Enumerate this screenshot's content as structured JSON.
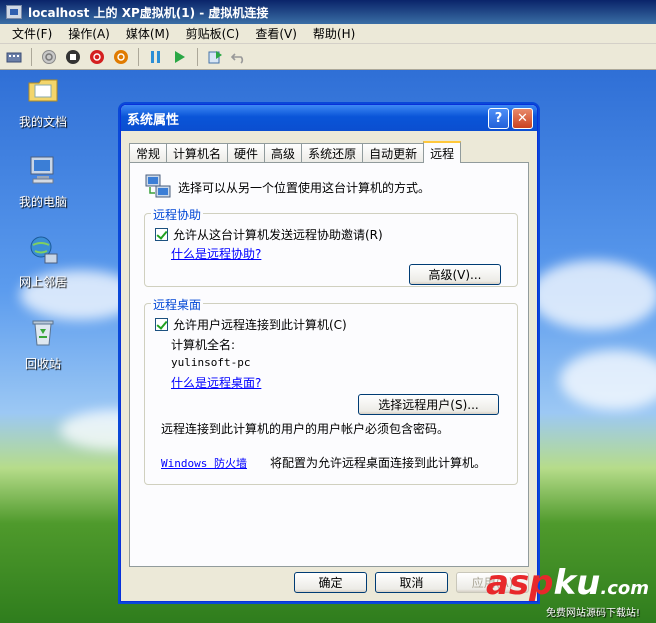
{
  "host": {
    "title": "localhost 上的 XP虚拟机(1) - 虚拟机连接",
    "menu": [
      "文件(F)",
      "操作(A)",
      "媒体(M)",
      "剪贴板(C)",
      "查看(V)",
      "帮助(H)"
    ]
  },
  "desktop": {
    "icons": [
      {
        "label": "我的文档"
      },
      {
        "label": "我的电脑"
      },
      {
        "label": "网上邻居"
      },
      {
        "label": "回收站"
      }
    ]
  },
  "dialog": {
    "title": "系统属性",
    "help_label": "?",
    "close_label": "✕",
    "tabs": [
      "常规",
      "计算机名",
      "硬件",
      "高级",
      "系统还原",
      "自动更新",
      "远程"
    ],
    "active_tab": "远程",
    "intro": "选择可以从另一个位置使用这台计算机的方式。",
    "remote_assistance": {
      "label": "远程协助",
      "checkbox": "允许从这台计算机发送远程协助邀请(R)",
      "checked": true,
      "link": "什么是远程协助?",
      "advanced_button": "高级(V)..."
    },
    "remote_desktop": {
      "label": "远程桌面",
      "checkbox": "允许用户远程连接到此计算机(C)",
      "checked": true,
      "fullname_label": "计算机全名:",
      "fullname_value": "yulinsoft-pc",
      "link": "什么是远程桌面?",
      "select_users_button": "选择远程用户(S)...",
      "password_note": "远程连接到此计算机的用户的用户帐户必须包含密码。",
      "firewall_link": "Windows 防火墙",
      "firewall_note": "将配置为允许远程桌面连接到此计算机。"
    },
    "buttons": {
      "ok": "确定",
      "cancel": "取消",
      "apply": "应用(A)"
    }
  },
  "watermark": {
    "logo_a": "asp",
    "logo_b": "ku",
    "logo_c": ".com",
    "subtitle": "免费网站源码下载站!"
  },
  "colors": {
    "title_bar": "#0a55d8",
    "group_label": "#0046d5",
    "link": "#0000ff",
    "face": "#ece9d8"
  }
}
